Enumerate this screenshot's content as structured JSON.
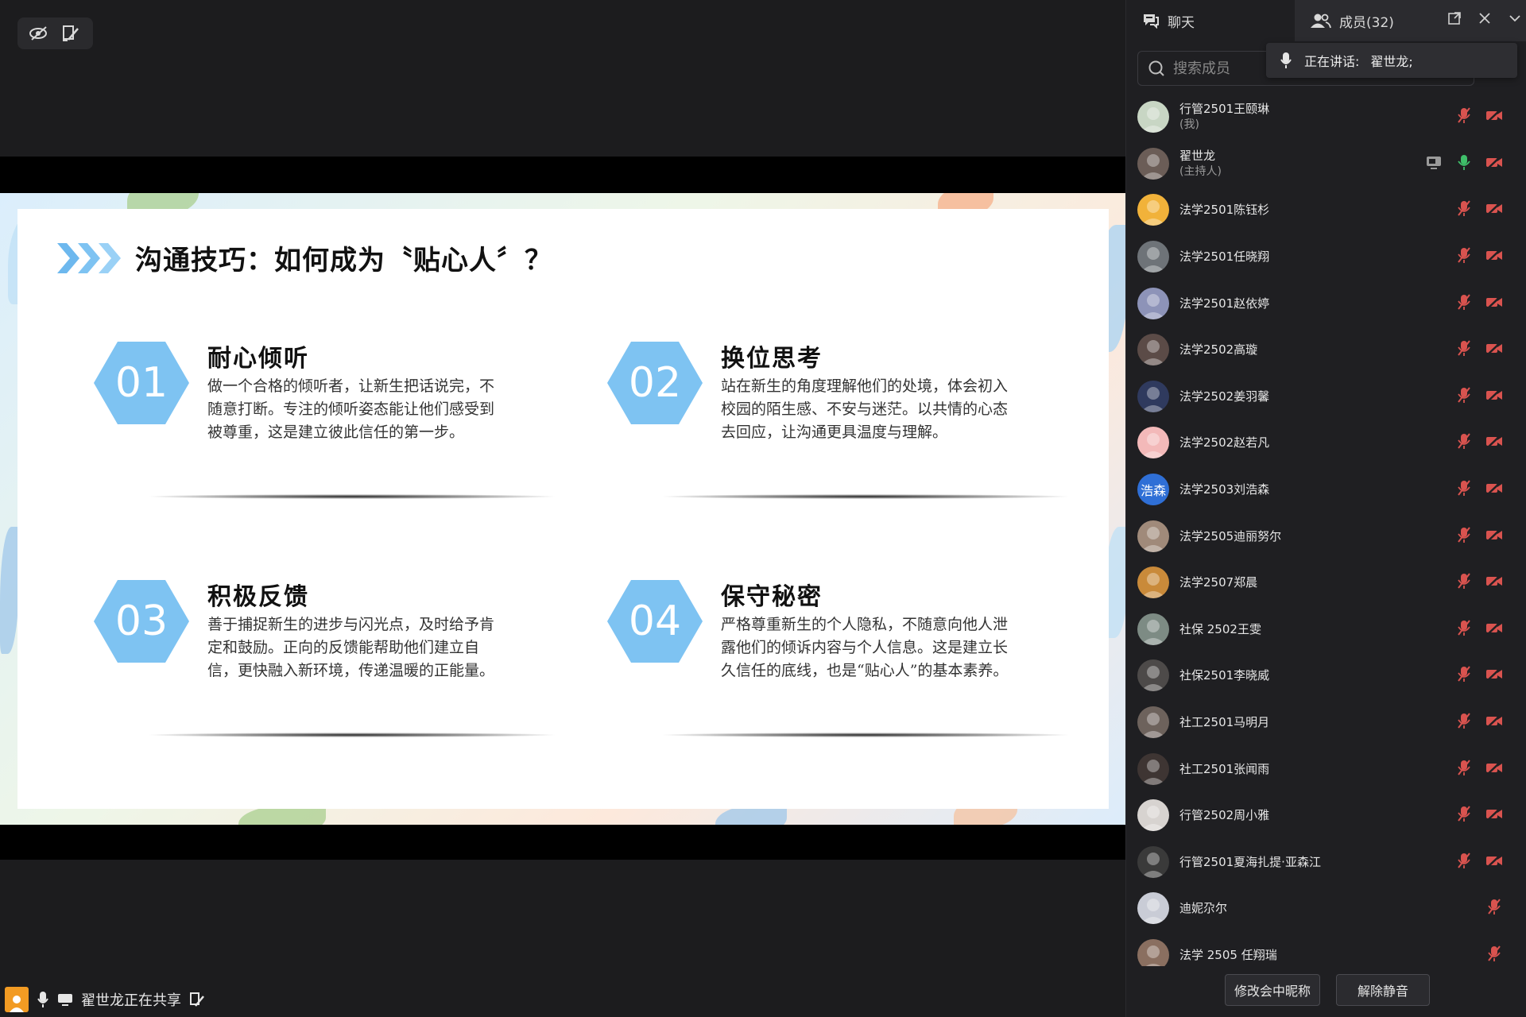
{
  "stage": {
    "sharing_status": "翟世龙正在共享",
    "slide": {
      "title": "沟通技巧：如何成为〝贴心人〞？",
      "accent_color": "#6db8ee",
      "cards": [
        {
          "num": "01",
          "title": "耐心倾听",
          "body": "做一个合格的倾听者，让新生把话说完，不随意打断。专注的倾听姿态能让他们感受到被尊重，这是建立彼此信任的第一步。"
        },
        {
          "num": "02",
          "title": "换位思考",
          "body": "站在新生的角度理解他们的处境，体会初入校园的陌生感、不安与迷茫。以共情的心态去回应，让沟通更具温度与理解。"
        },
        {
          "num": "03",
          "title": "积极反馈",
          "body": "善于捕捉新生的进步与闪光点，及时给予肯定和鼓励。正向的反馈能帮助他们建立自信，更快融入新环境，传递温暖的正能量。"
        },
        {
          "num": "04",
          "title": "保守秘密",
          "body": "严格尊重新生的个人隐私，不随意向他人泄露他们的倾诉内容与个人信息。这是建立长久信任的底线，也是“贴心人”的基本素养。"
        }
      ]
    }
  },
  "panel": {
    "tab_chat": "聊天",
    "tab_members": "成员(32)",
    "search_placeholder": "搜索成员",
    "speaking_label": "正在讲话:",
    "speaking_name": "翟世龙;",
    "members": [
      {
        "name": "行管2501王颐琳",
        "sub": "(我)",
        "avatar_color": "#c8d6c4",
        "mic": "muted",
        "cam": true,
        "share": false
      },
      {
        "name": "翟世龙",
        "sub": "(主持人)",
        "avatar_color": "#6b5d57",
        "mic": "on",
        "cam": true,
        "share": true
      },
      {
        "name": "法学2501陈钰杉",
        "sub": "",
        "avatar_color": "#f1b23a",
        "mic": "muted",
        "cam": true,
        "share": false
      },
      {
        "name": "法学2501任晓翔",
        "sub": "",
        "avatar_color": "#6e7378",
        "mic": "muted",
        "cam": true,
        "share": false
      },
      {
        "name": "法学2501赵依婷",
        "sub": "",
        "avatar_color": "#8d93b8",
        "mic": "muted",
        "cam": true,
        "share": false
      },
      {
        "name": "法学2502高璇",
        "sub": "",
        "avatar_color": "#5b4b47",
        "mic": "muted",
        "cam": true,
        "share": false
      },
      {
        "name": "法学2502姜羽馨",
        "sub": "",
        "avatar_color": "#2f3a5e",
        "mic": "muted",
        "cam": true,
        "share": false
      },
      {
        "name": "法学2502赵若凡",
        "sub": "",
        "avatar_color": "#f3b9b9",
        "mic": "muted",
        "cam": true,
        "share": false
      },
      {
        "name": "法学2503刘浩森",
        "sub": "",
        "avatar_color": "#2f6fd6",
        "avatar_text": "浩森",
        "mic": "muted",
        "cam": true,
        "share": false
      },
      {
        "name": "法学2505迪丽努尔",
        "sub": "",
        "avatar_color": "#a08a7a",
        "mic": "muted",
        "cam": true,
        "share": false
      },
      {
        "name": "法学2507郑晨",
        "sub": "",
        "avatar_color": "#c98a3a",
        "mic": "muted",
        "cam": true,
        "share": false
      },
      {
        "name": "社保 2502王雯",
        "sub": "",
        "avatar_color": "#7d8b84",
        "mic": "muted",
        "cam": true,
        "share": false
      },
      {
        "name": "社保2501李晓威",
        "sub": "",
        "avatar_color": "#4d4a49",
        "mic": "muted",
        "cam": true,
        "share": false
      },
      {
        "name": "社工2501马明月",
        "sub": "",
        "avatar_color": "#6d625c",
        "mic": "muted",
        "cam": true,
        "share": false
      },
      {
        "name": "社工2501张闻雨",
        "sub": "",
        "avatar_color": "#3e3533",
        "mic": "muted",
        "cam": true,
        "share": false
      },
      {
        "name": "行管2502周小雅",
        "sub": "",
        "avatar_color": "#d7d3d0",
        "mic": "muted",
        "cam": true,
        "share": false
      },
      {
        "name": "行管2501夏海扎提·亚森江",
        "sub": "",
        "avatar_color": "#3a3a3a",
        "mic": "muted",
        "cam": true,
        "share": false
      },
      {
        "name": "迪妮尕尔",
        "sub": "",
        "avatar_color": "#c9ccd6",
        "mic": "muted",
        "cam": false,
        "share": false
      },
      {
        "name": "法学 2505 任翔瑞",
        "sub": "",
        "avatar_color": "#8a6f60",
        "mic": "muted",
        "cam": false,
        "share": false
      }
    ],
    "rename_button": "修改会中昵称",
    "unmute_button": "解除静音"
  },
  "colors": {
    "mic_muted": "#d9534f",
    "mic_on": "#3fbf6a",
    "panel_bg": "#1f1f22",
    "stage_bg": "#1c1c1e"
  }
}
